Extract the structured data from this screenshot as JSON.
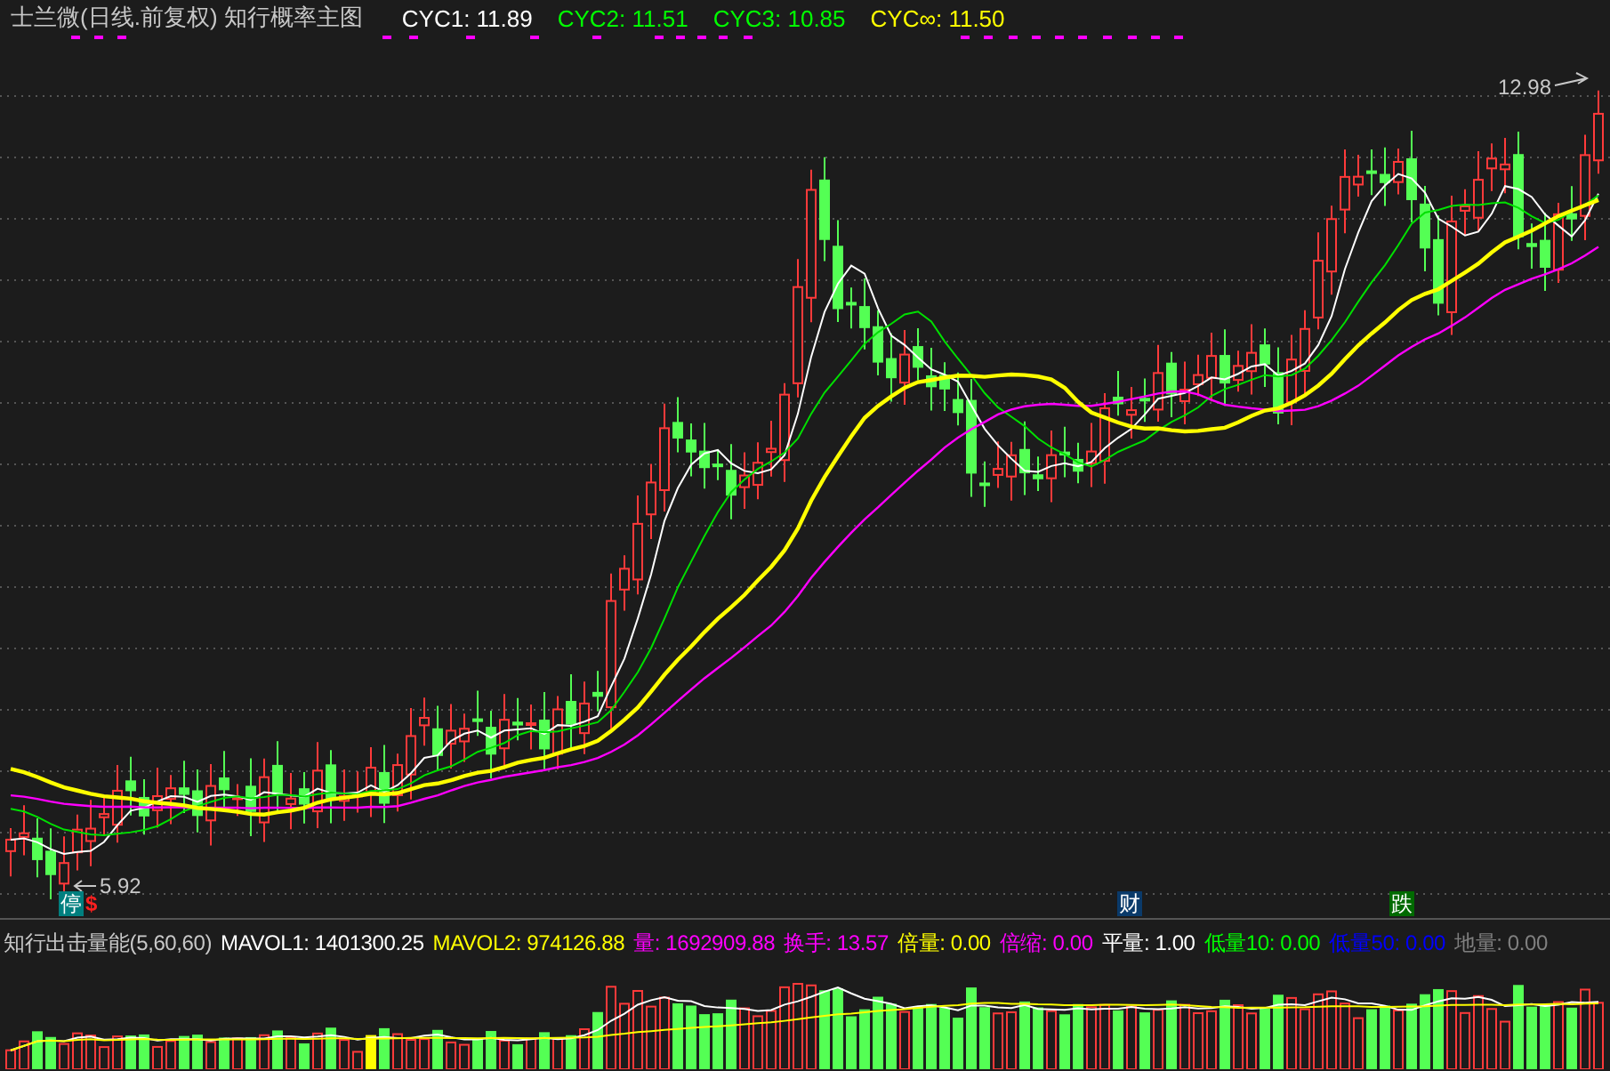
{
  "header": {
    "title": "士兰微(日线.前复权) 知行概率主图",
    "legend": [
      {
        "text": "CYC1: 11.89",
        "color": "#ffffff"
      },
      {
        "text": "CYC2: 11.51",
        "color": "#00ff00"
      },
      {
        "text": "CYC3: 10.85",
        "color": "#00ff00"
      },
      {
        "text": "CYC∞: 11.50",
        "color": "#ffff00"
      }
    ]
  },
  "chart": {
    "high_label": "12.98",
    "low_label": "5.92",
    "markers": [
      {
        "text": "停",
        "kind": "stop"
      },
      {
        "text": "$",
        "kind": "dollar"
      },
      {
        "text": "财",
        "kind": "finance"
      },
      {
        "text": "跌",
        "kind": "fall"
      }
    ]
  },
  "indicator": {
    "title": "知行出击量能(5,60,60)",
    "legend": [
      {
        "text": "MAVOL1: 1401300.25",
        "color": "#ffffff"
      },
      {
        "text": "MAVOL2: 974126.88",
        "color": "#ffff00"
      },
      {
        "text": "量: 1692909.88",
        "color": "#ff00ff"
      },
      {
        "text": "换手: 13.57",
        "color": "#ff00ff"
      },
      {
        "text": "倍量: 0.00",
        "color": "#ffff00"
      },
      {
        "text": "倍缩: 0.00",
        "color": "#ff00ff"
      },
      {
        "text": "平量: 1.00",
        "color": "#ffffff"
      },
      {
        "text": "低量10: 0.00",
        "color": "#00ff00"
      },
      {
        "text": "低量50: 0.00",
        "color": "#0000ff"
      },
      {
        "text": "地量: 0.00",
        "color": "#808080"
      }
    ]
  }
}
